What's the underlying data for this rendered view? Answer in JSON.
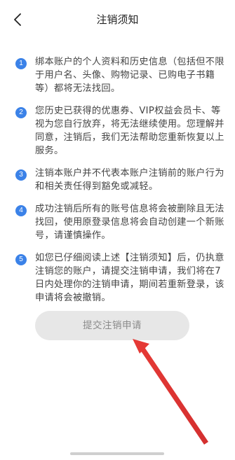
{
  "header": {
    "title": "注销须知",
    "back_icon": "chevron-left-icon"
  },
  "notices": [
    {
      "num": "1",
      "text": "绑本账户的个人资料和历史信息（包括但不限于用户名、头像、购物记录、已购电子书籍等）都将无法找回。"
    },
    {
      "num": "2",
      "text": "您历史已获得的优惠券、VIP权益会员卡、等视为您自行放弃，将无法继续使用。您理解并同意，注销后，我们无法帮助您重新恢复以上服务。"
    },
    {
      "num": "3",
      "text": "注销本账户并不代表本账户注销前的账户行为和相关责任得到豁免或减轻。"
    },
    {
      "num": "4",
      "text": "成功注销后所有的账号信息将会被删除且无法找回，使用原登录信息将会自动创建一个新账号，请谨慎操作。"
    },
    {
      "num": "5",
      "text": "如您已仔细阅读上述【注销须知】后，仍执意注销您的账户，请提交注销申请，我们将在7日内处理你的注销申请，期间若重新登录，该申请将会被撤销。"
    }
  ],
  "submit_button": {
    "label": "提交注销申请"
  },
  "colors": {
    "badge": "#3b82e8",
    "button_bg": "#e7e7e7",
    "button_text": "#8a8a8a",
    "annotation_arrow": "#e53935"
  }
}
